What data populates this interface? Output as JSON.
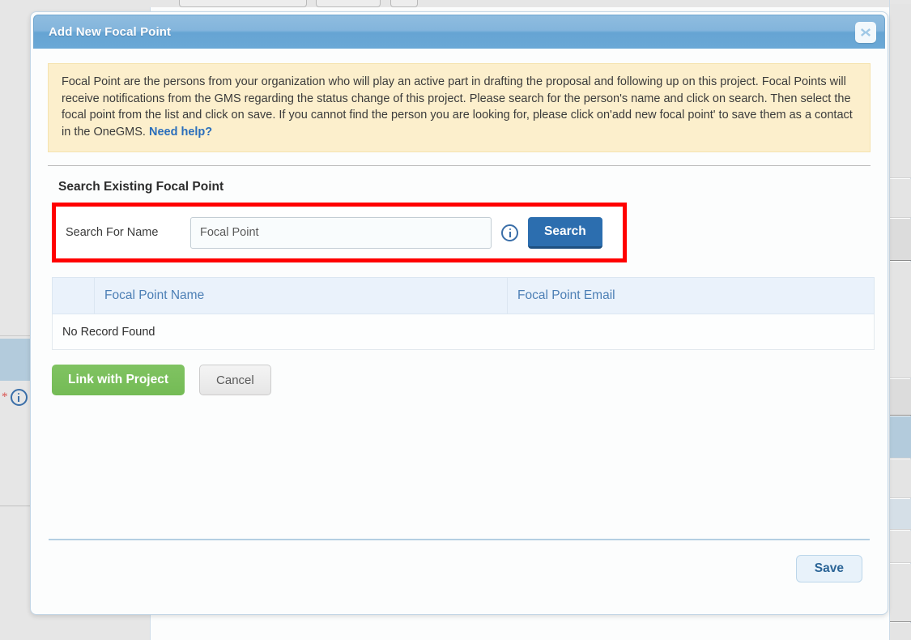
{
  "modal": {
    "title": "Add New Focal Point",
    "close_icon": "close-icon",
    "notice": {
      "text": "Focal Point are the persons from your organization who will play an active part in drafting the proposal and following up on this project. Focal Points will receive notifications from the GMS regarding the status change of this project. Please search for the person's name and click on search. Then select the focal point from the list and click on save. If you cannot find the person you are looking for, please click on'add new focal point' to save them as a contact in the OneGMS.",
      "help_link": "Need help?"
    },
    "section_heading": "Search Existing Focal Point",
    "search": {
      "label": "Search For Name",
      "value": "",
      "placeholder": "Focal Point",
      "info_icon": "info-icon",
      "button_label": "Search"
    },
    "table": {
      "columns": [
        "",
        "Focal Point Name",
        "Focal Point Email"
      ],
      "empty_message": "No Record Found",
      "rows": []
    },
    "actions": {
      "link_label": "Link with Project",
      "cancel_label": "Cancel"
    },
    "footer": {
      "save_label": "Save"
    }
  },
  "colors": {
    "header_blue": "#6aa8d6",
    "notice_bg": "#fcefcc",
    "highlight_red": "#ff0000",
    "search_blue": "#2c6eaf",
    "link_green": "#74bb55",
    "save_blue": "#2a6496",
    "table_header_text": "#4c7fb5"
  }
}
